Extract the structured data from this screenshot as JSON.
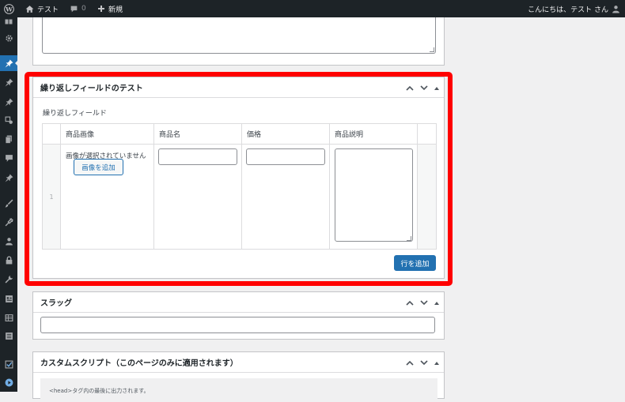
{
  "adminbar": {
    "site_name": "テスト",
    "comments_count": "0",
    "new_label": "新規",
    "greeting": "こんにちは、テスト さん"
  },
  "repeater_box": {
    "title": "繰り返しフィールドのテスト",
    "field_label": "繰り返しフィールド",
    "columns": [
      "商品画像",
      "商品名",
      "価格",
      "商品説明"
    ],
    "rows": [
      {
        "index": "1",
        "no_image_text": "画像が選択されていません",
        "add_image_label": "画像を追加",
        "name": "",
        "price": "",
        "description": ""
      }
    ],
    "add_row_label": "行を追加",
    "highlight_color": "#ff0000"
  },
  "slug_box": {
    "title": "スラッグ",
    "value": ""
  },
  "custom_script_box": {
    "title": "カスタムスクリプト（このページのみに適用されます）",
    "hint": "<head>タグ内の最後に出力されます。"
  },
  "colors": {
    "primary": "#2271b1",
    "adminbar": "#1d2327"
  }
}
